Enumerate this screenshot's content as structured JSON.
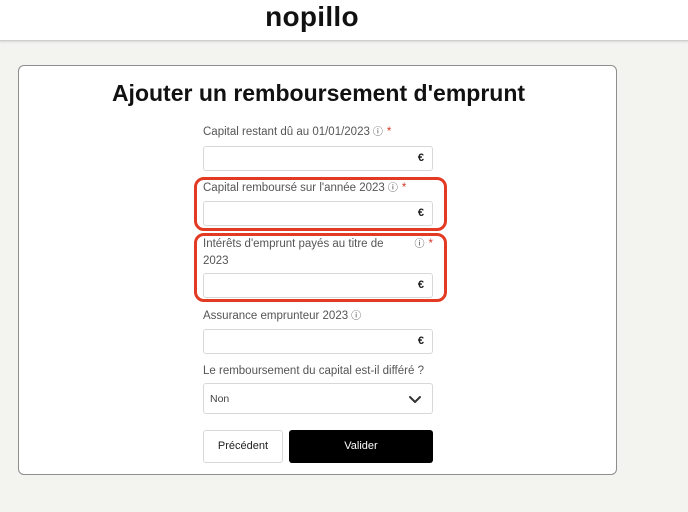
{
  "header": {
    "logo_text": "nopillo"
  },
  "form": {
    "title": "Ajouter un remboursement d'emprunt",
    "fields": [
      {
        "label": "Capital restant dû au 01/01/2023",
        "required": "*",
        "unit": "€",
        "value": ""
      },
      {
        "label": "Capital remboursé sur l'année 2023",
        "required": "*",
        "unit": "€",
        "value": ""
      },
      {
        "label_line1": "Intérêts d'emprunt payés au titre de",
        "label_line2": "2023",
        "required": "*",
        "unit": "€",
        "value": ""
      },
      {
        "label": "Assurance emprunteur 2023",
        "unit": "€",
        "value": ""
      }
    ],
    "deferred": {
      "label": "Le remboursement du capital est-il différé ?",
      "selected": "Non"
    },
    "buttons": {
      "previous": "Précédent",
      "submit": "Valider"
    }
  },
  "icons": {
    "info": "info-icon",
    "dropdown": "chevron-down-icon"
  },
  "colors": {
    "highlight": "#e33b23",
    "required": "#d33a2a",
    "primary_button": "#000000"
  }
}
